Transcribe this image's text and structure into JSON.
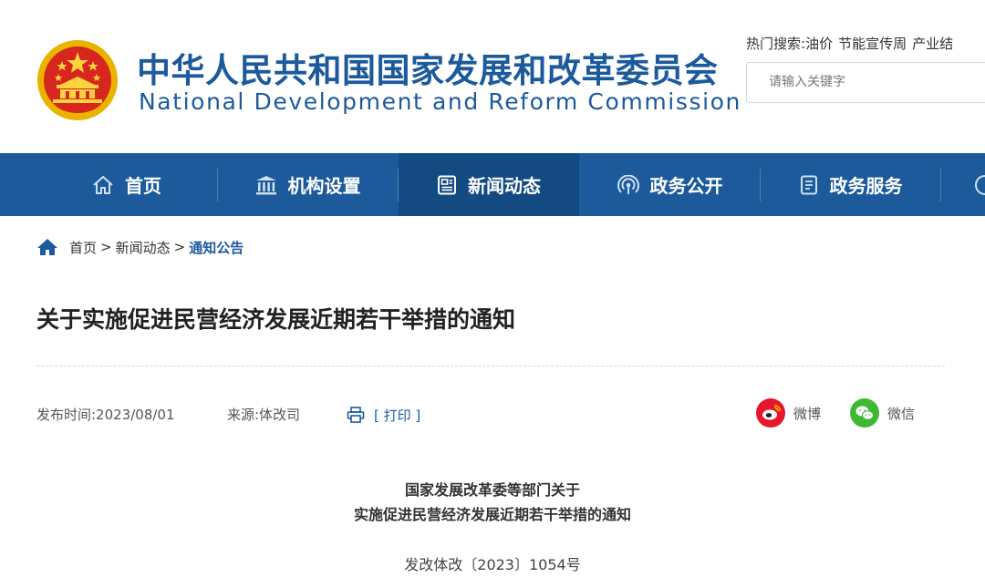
{
  "header": {
    "title_cn": "中华人民共和国国家发展和改革委员会",
    "title_en": "National Development and Reform Commission",
    "hot_search_label": "热门搜索:",
    "hot_search_items": [
      "油价",
      "节能宣传周",
      "产业结"
    ],
    "search_placeholder": "请输入关键字",
    "brand_color": "#1c5a9c"
  },
  "nav": {
    "items": [
      {
        "label": "首页",
        "icon": "home-icon"
      },
      {
        "label": "机构设置",
        "icon": "building-icon"
      },
      {
        "label": "新闻动态",
        "icon": "news-icon",
        "active": true
      },
      {
        "label": "政务公开",
        "icon": "broadcast-icon"
      },
      {
        "label": "政务服务",
        "icon": "document-icon"
      }
    ],
    "bg_color": "#1c5a9c",
    "active_color": "#144a82"
  },
  "breadcrumb": {
    "items": [
      "首页",
      "新闻动态"
    ],
    "separator": ">",
    "current": "通知公告"
  },
  "article": {
    "title": "关于实施促进民营经济发展近期若干举措的通知",
    "publish_label": "发布时间:2023/08/01",
    "source_label": "来源:体改司",
    "print_label": "[ 打印 ]",
    "share": [
      {
        "label": "微博",
        "icon": "weibo-icon",
        "color": "#e6162d"
      },
      {
        "label": "微信",
        "icon": "wechat-icon",
        "color": "#3fb935"
      }
    ],
    "doc_heading_line1": "国家发展改革委等部门关于",
    "doc_heading_line2": "实施促进民营经济发展近期若干举措的通知",
    "doc_number": "发改体改〔2023〕1054号"
  }
}
